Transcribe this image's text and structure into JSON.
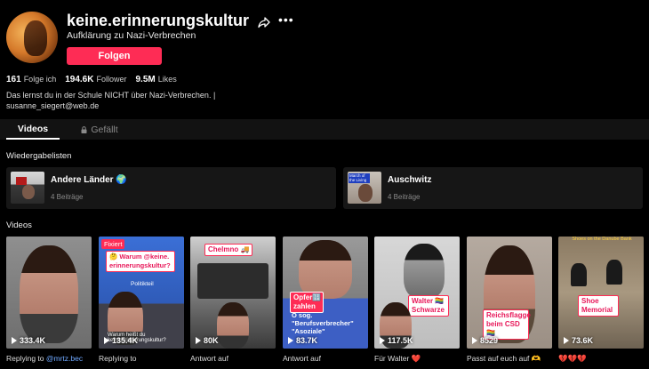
{
  "profile": {
    "username": "keine.erinnerungskultur",
    "subtitle": "Aufklärung zu Nazi-Verbrechen",
    "follow_label": "Folgen",
    "stats": [
      {
        "value": "161",
        "label": "Folge ich"
      },
      {
        "value": "194.6K",
        "label": "Follower"
      },
      {
        "value": "9.5M",
        "label": "Likes"
      }
    ],
    "bio_line1": "Das lernst du in der Schule NICHT über Nazi-Verbrechen. |",
    "bio_line2": "susanne_siegert@web.de"
  },
  "tabs": [
    {
      "label": "Videos"
    },
    {
      "label": "Gefällt"
    }
  ],
  "playlists_title": "Wiedergabelisten",
  "playlists": [
    {
      "name": "Andere Länder 🌍",
      "count": "4 Beiträge"
    },
    {
      "name": "Auschwitz",
      "count": "4 Beiträge",
      "thumb_text": "March of the Living"
    }
  ],
  "videos_title": "Videos",
  "videos": [
    {
      "views": "333.4K",
      "caption": "Replying to ",
      "mention": "@mrtz.bec"
    },
    {
      "views": "135.4K",
      "caption": "Replying to",
      "pinned": "Fixiert",
      "sticker": "🤔 Warum @keine. erinnerungskultur?",
      "sticker2": "Warum heißt du keine.erinnerungskultur?",
      "label": "Politikteil"
    },
    {
      "views": "80K",
      "caption": "Antwort auf",
      "sticker": "Chelmno 🚚"
    },
    {
      "views": "83.7K",
      "caption": "Antwort auf",
      "sticker": "Opfer🔢 zahlen",
      "overlay": "O sog. \"Berufsverbrecher\" \"Asoziale\""
    },
    {
      "views": "117.5K",
      "caption": "Für Walter ❤️",
      "sticker": "Walter 🏳️‍🌈 Schwarze"
    },
    {
      "views": "8529",
      "caption": "Passt auf euch auf 🫶",
      "sticker": "Reichsflagge beim CSD 🏳️‍🌈"
    },
    {
      "views": "73.6K",
      "caption": "💔💔💔",
      "sticker": "Shoe Memorial",
      "top_text": "Shoes on the Danube Bank"
    }
  ],
  "colors": {
    "accent": "#fe2c55",
    "background": "#000000",
    "surface": "#161616"
  }
}
